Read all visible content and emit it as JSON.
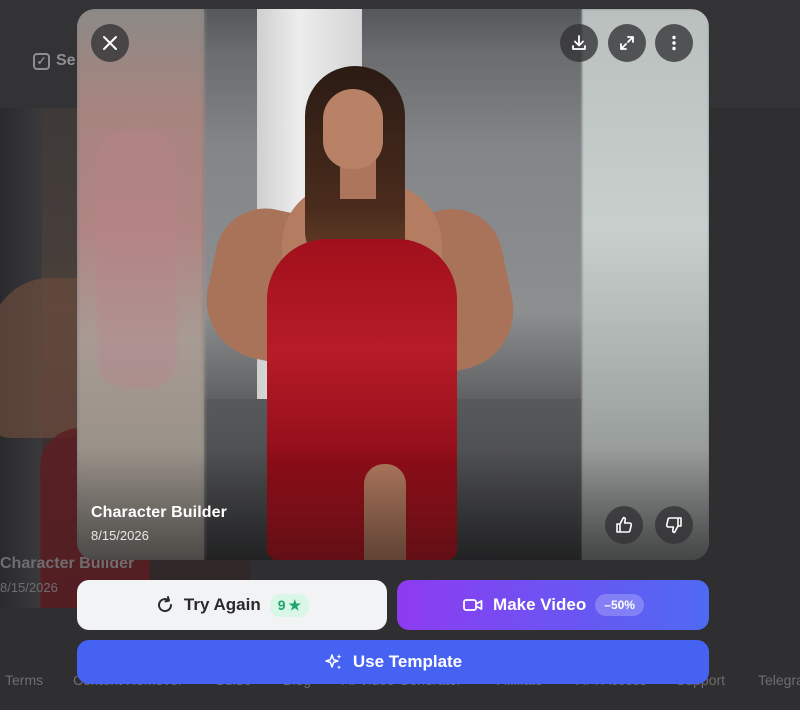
{
  "background": {
    "select_label": "Se",
    "card_title": "Character Builder",
    "card_date": "8/15/2026",
    "footer_links": [
      "Terms",
      "Content Remover",
      "Guide",
      "Blog",
      "AI Video Generator",
      "Affiliate",
      "API Access",
      "Support",
      "Telegra"
    ]
  },
  "viewer": {
    "title": "Character Builder",
    "date": "8/15/2026",
    "icons": {
      "close": "close-icon",
      "download": "download-icon",
      "expand": "expand-icon",
      "more": "more-vertical-icon",
      "like": "thumbs-up-icon",
      "dislike": "thumbs-down-icon"
    }
  },
  "actions": {
    "try_again": {
      "label": "Try Again",
      "cost": "9"
    },
    "make_video": {
      "label": "Make Video",
      "discount": "–50%"
    },
    "use_template": {
      "label": "Use Template"
    }
  },
  "colors": {
    "page_bg": "#2f2f31",
    "try_again_bg": "#f2f3f5",
    "cost_badge_bg": "#d9f6e7",
    "cost_badge_text": "#1ea56a",
    "video_gradient_start": "#8e3bf0",
    "video_gradient_end": "#4f6af2",
    "template_bg": "#4662f3"
  }
}
